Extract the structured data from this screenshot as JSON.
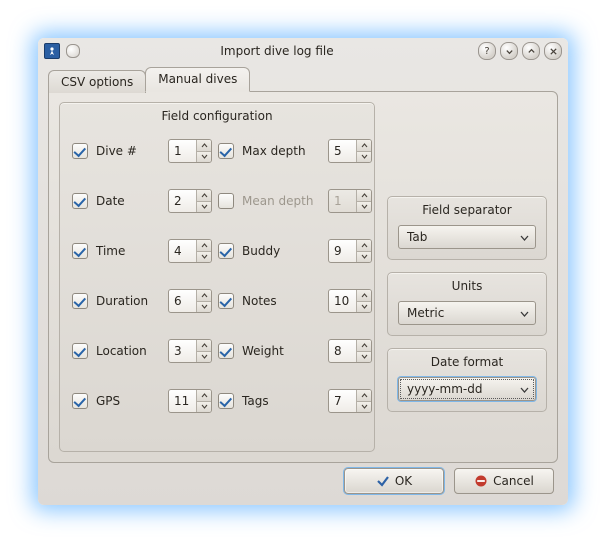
{
  "window": {
    "title": "Import dive log file"
  },
  "tabs": {
    "csv": "CSV options",
    "manual": "Manual dives"
  },
  "field_config": {
    "title": "Field configuration",
    "rows": [
      {
        "l_label": "Dive #",
        "l_val": "1",
        "l_on": true,
        "r_label": "Max depth",
        "r_val": "5",
        "r_on": true,
        "r_enabled": true
      },
      {
        "l_label": "Date",
        "l_val": "2",
        "l_on": true,
        "r_label": "Mean depth",
        "r_val": "1",
        "r_on": false,
        "r_enabled": false
      },
      {
        "l_label": "Time",
        "l_val": "4",
        "l_on": true,
        "r_label": "Buddy",
        "r_val": "9",
        "r_on": true,
        "r_enabled": true
      },
      {
        "l_label": "Duration",
        "l_val": "6",
        "l_on": true,
        "r_label": "Notes",
        "r_val": "10",
        "r_on": true,
        "r_enabled": true
      },
      {
        "l_label": "Location",
        "l_val": "3",
        "l_on": true,
        "r_label": "Weight",
        "r_val": "8",
        "r_on": true,
        "r_enabled": true
      },
      {
        "l_label": "GPS",
        "l_val": "11",
        "l_on": true,
        "r_label": "Tags",
        "r_val": "7",
        "r_on": true,
        "r_enabled": true
      }
    ]
  },
  "separator": {
    "title": "Field separator",
    "value": "Tab"
  },
  "units": {
    "title": "Units",
    "value": "Metric"
  },
  "dateformat": {
    "title": "Date format",
    "value": "yyyy-mm-dd"
  },
  "buttons": {
    "ok": "OK",
    "cancel": "Cancel"
  }
}
